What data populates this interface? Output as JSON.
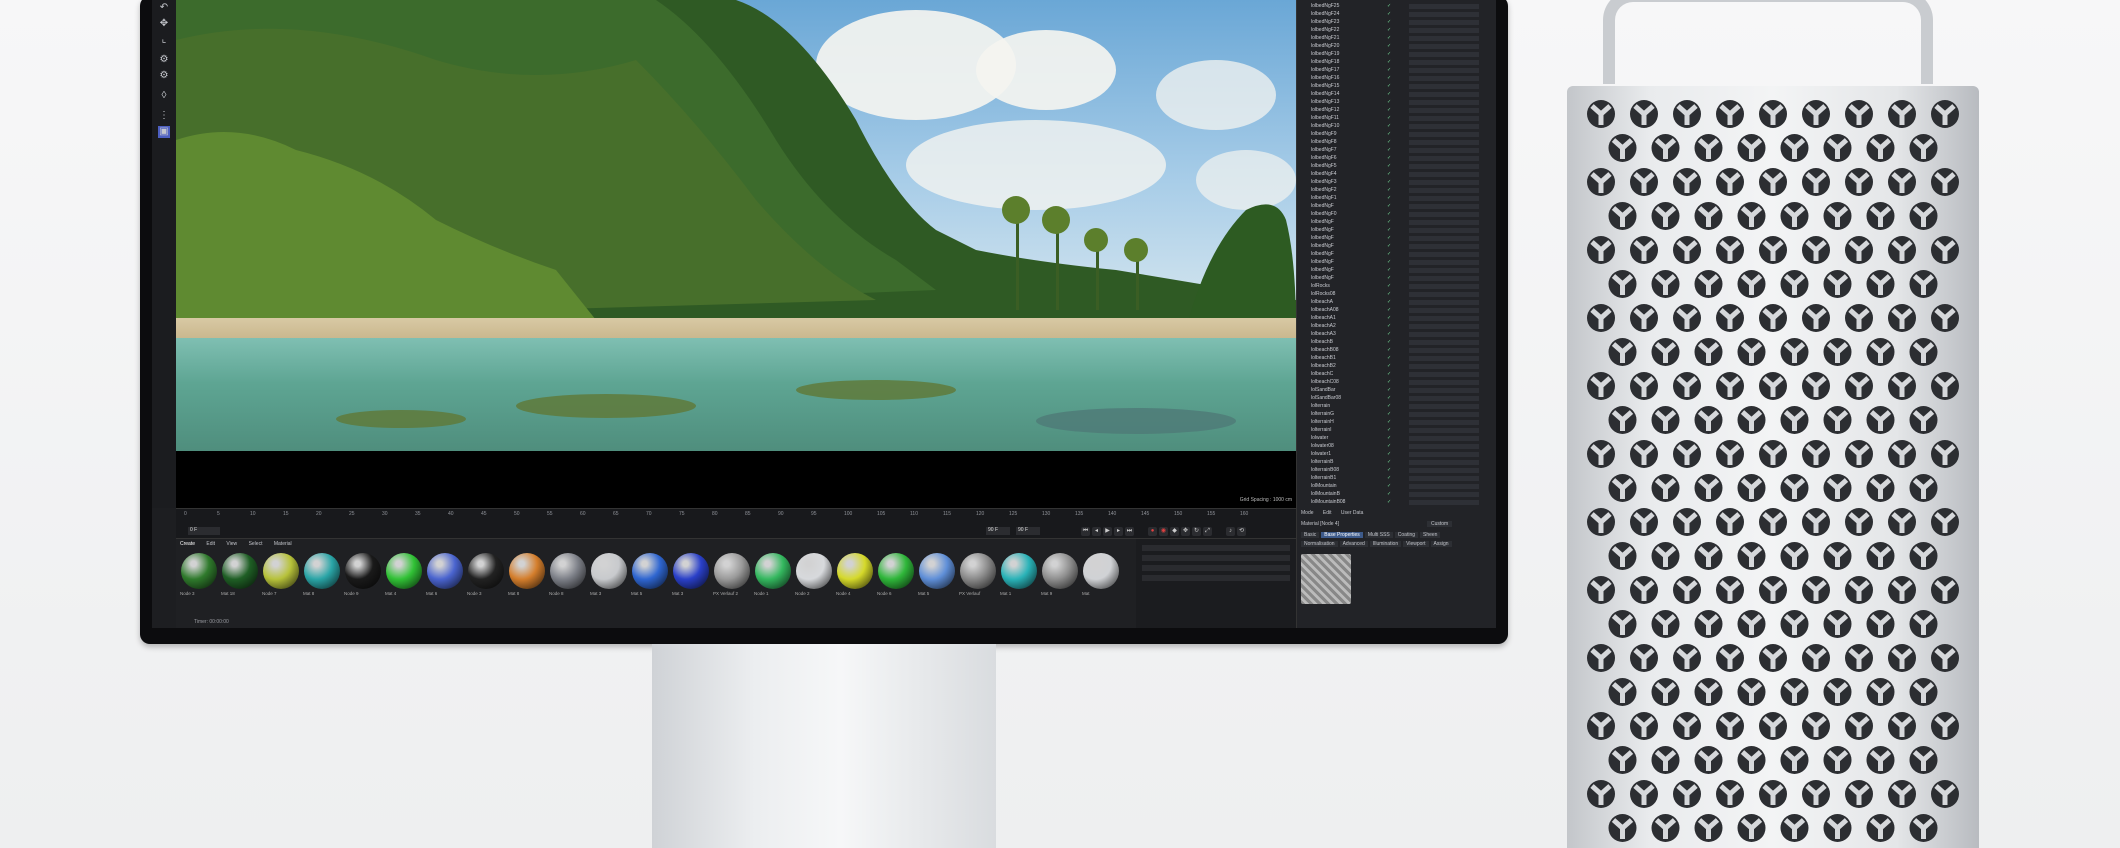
{
  "viewport": {
    "info_label": "Grid Spacing : 1000 cm"
  },
  "timeline": {
    "ticks": [
      "0",
      "5",
      "10",
      "15",
      "20",
      "25",
      "30",
      "35",
      "40",
      "45",
      "50",
      "55",
      "60",
      "65",
      "70",
      "75",
      "80",
      "85",
      "90",
      "95",
      "100",
      "105",
      "110",
      "115",
      "120",
      "125",
      "130",
      "135",
      "140",
      "145",
      "150",
      "155",
      "160"
    ],
    "current_frame": "0 F",
    "end_frame": "90 F",
    "end_frame_b": "90 F"
  },
  "material_manager": {
    "tabs": [
      "Create",
      "Edit",
      "View",
      "Select",
      "Material"
    ],
    "materials": [
      {
        "label": "Node 3",
        "color": "#2f7a2c"
      },
      {
        "label": "Mat 18",
        "color": "#1f5f25"
      },
      {
        "label": "Node 7",
        "color": "#b7c23a"
      },
      {
        "label": "Mat 8",
        "color": "#2aa5a7"
      },
      {
        "label": "Node 9",
        "color": "#1a1a1a"
      },
      {
        "label": "Mat 4",
        "color": "#31c236"
      },
      {
        "label": "Mat 6",
        "color": "#4a64cf"
      },
      {
        "label": "Node 3",
        "color": "#222222"
      },
      {
        "label": "Mat 8",
        "color": "#d47e2c"
      },
      {
        "label": "Node 8",
        "color": "#7d8088"
      },
      {
        "label": "Mat 3",
        "color": "#c8cacd"
      },
      {
        "label": "Mat 5",
        "color": "#2f66d1"
      },
      {
        "label": "Mat 3",
        "color": "#2a40c9"
      },
      {
        "label": "PX Verlauf 2",
        "color": "#9a9a9a"
      },
      {
        "label": "Node 1",
        "color": "#34b85f"
      },
      {
        "label": "Node 2",
        "color": "#d7d9dc"
      },
      {
        "label": "Node 4",
        "color": "#d5d92a"
      },
      {
        "label": "Node 6",
        "color": "#2fb73a"
      },
      {
        "label": "Mat 5",
        "color": "#5f8fd8"
      },
      {
        "label": "PX Verlauf",
        "color": "#8a8a8a"
      },
      {
        "label": "Mat 1",
        "color": "#2ab3b8"
      },
      {
        "label": "Mat 9",
        "color": "#8f8f8f"
      },
      {
        "label": "Mat",
        "color": "#d0d2d5"
      }
    ],
    "status": "Timer: 00:00:00"
  },
  "object_manager": {
    "rows": [
      "lolbedNgF25",
      "lolbedNgF24",
      "lolbedNgF23",
      "lolbedNgF22",
      "lolbedNgF21",
      "lolbedNgF20",
      "lolbedNgF19",
      "lolbedNgF18",
      "lolbedNgF17",
      "lolbedNgF16",
      "lolbedNgF15",
      "lolbedNgF14",
      "lolbedNgF13",
      "lolbedNgF12",
      "lolbedNgF11",
      "lolbedNgF10",
      "lolbedNgF9",
      "lolbedNgF8",
      "lolbedNgF7",
      "lolbedNgF6",
      "lolbedNgF5",
      "lolbedNgF4",
      "lolbedNgF3",
      "lolbedNgF2",
      "lolbedNgF1",
      "lolbedNgF",
      "lolbedNgF0",
      "lolbedNgF",
      "lolbedNgF",
      "lolbedNgF",
      "lolbedNgF",
      "lolbedNgF",
      "lolbedNgF",
      "lolbedNgF",
      "lolbedNgF",
      "lolRocks",
      "lolRocks08",
      "lolbeachA",
      "lolbeachA08",
      "lolbeachA1",
      "lolbeachA2",
      "lolbeachA3",
      "lolbeachB",
      "lolbeachB08",
      "lolbeachB1",
      "lolbeachB2",
      "lolbeachC",
      "lolbeachC08",
      "lolSandBar",
      "lolSandBar08",
      "lolterrain",
      "lolterrainG",
      "lolterrainH",
      "lolterrainI",
      "lolwater",
      "lolwater08",
      "lolwater1",
      "lolterrainB",
      "lolterrainB08",
      "lolterrainB1",
      "lolMountain",
      "lolMountainB",
      "lolMountainB08"
    ]
  },
  "attribute_manager": {
    "menu": [
      "Mode",
      "Edit",
      "User Data"
    ],
    "title": "Material [Node 4]",
    "mode": "Custom",
    "tabs": [
      "Basic",
      "Base Properties",
      "Multi SSS",
      "Coating",
      "Sheen"
    ],
    "subtabs": [
      "Normalisation",
      "Advanced",
      "Illumination",
      "Viewport",
      "Assign"
    ]
  }
}
